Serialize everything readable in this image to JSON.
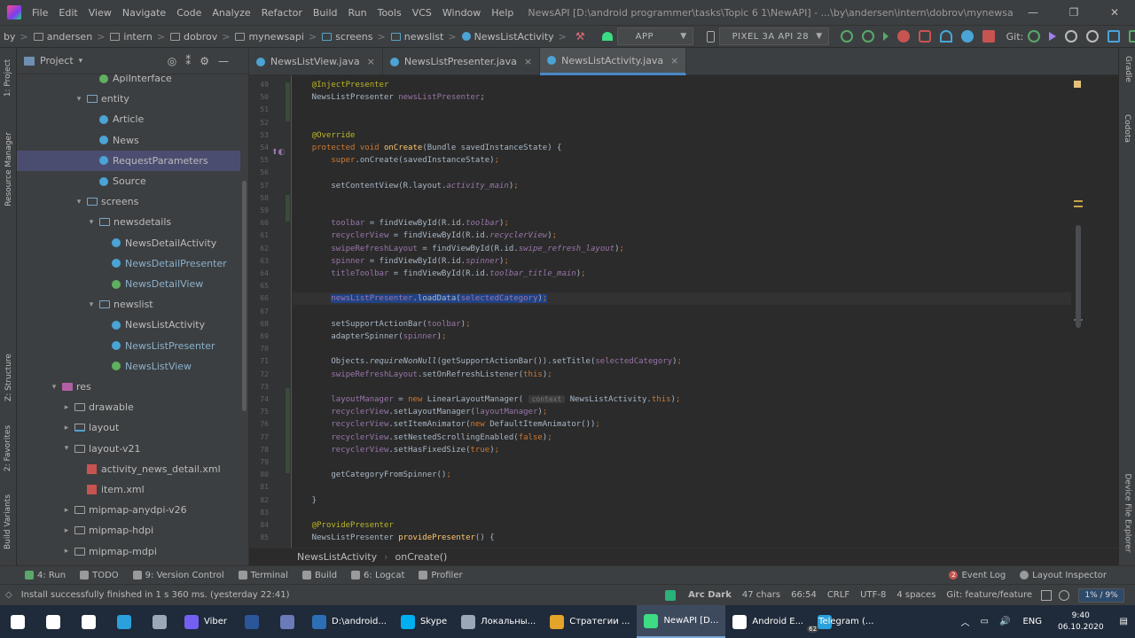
{
  "menu": [
    "File",
    "Edit",
    "View",
    "Navigate",
    "Code",
    "Analyze",
    "Refactor",
    "Build",
    "Run",
    "Tools",
    "VCS",
    "Window",
    "Help"
  ],
  "window_title": "NewsAPI [D:\\android programmer\\tasks\\Topic 6 1\\NewAPI] - ...\\by\\andersen\\intern\\dobrov\\mynewsapi\\screens\\newslist\\NewsListActivity.java [app]",
  "window_controls": [
    "—",
    "❐",
    "✕"
  ],
  "breadcrumbs": [
    "by",
    "andersen",
    "intern",
    "dobrov",
    "mynewsapi",
    "screens",
    "newslist",
    "NewsListActivity"
  ],
  "run_config": "APP",
  "device": "PIXEL 3A API 28",
  "git_label": "Git:",
  "left_stripe": [
    "1: Project",
    "Resource Manager",
    "Z: Structure",
    "2: Favorites",
    "Build Variants"
  ],
  "right_stripe": [
    "Gradle",
    "Codota",
    "Device File Explorer"
  ],
  "project_panel": {
    "title": "Project",
    "tree": [
      {
        "label": "ApiInterface",
        "icon": "interface",
        "indent": 6,
        "twisty": ""
      },
      {
        "label": "entity",
        "icon": "package",
        "indent": 5,
        "twisty": "▾"
      },
      {
        "label": "Article",
        "icon": "class",
        "indent": 6,
        "twisty": ""
      },
      {
        "label": "News",
        "icon": "class",
        "indent": 6,
        "twisty": ""
      },
      {
        "label": "RequestParameters",
        "icon": "class",
        "indent": 6,
        "twisty": "",
        "selected": true
      },
      {
        "label": "Source",
        "icon": "class",
        "indent": 6,
        "twisty": ""
      },
      {
        "label": "screens",
        "icon": "package",
        "indent": 5,
        "twisty": "▾"
      },
      {
        "label": "newsdetails",
        "icon": "package",
        "indent": 6,
        "twisty": "▾"
      },
      {
        "label": "NewsDetailActivity",
        "icon": "class",
        "indent": 7,
        "twisty": ""
      },
      {
        "label": "NewsDetailPresenter",
        "icon": "class",
        "indent": 7,
        "twisty": "",
        "muted": true
      },
      {
        "label": "NewsDetailView",
        "icon": "interface",
        "indent": 7,
        "twisty": "",
        "muted": true
      },
      {
        "label": "newslist",
        "icon": "package",
        "indent": 6,
        "twisty": "▾"
      },
      {
        "label": "NewsListActivity",
        "icon": "class",
        "indent": 7,
        "twisty": ""
      },
      {
        "label": "NewsListPresenter",
        "icon": "class",
        "indent": 7,
        "twisty": "",
        "muted": true
      },
      {
        "label": "NewsListView",
        "icon": "interface",
        "indent": 7,
        "twisty": "",
        "muted": true
      },
      {
        "label": "res",
        "icon": "res",
        "indent": 3,
        "twisty": "▾"
      },
      {
        "label": "drawable",
        "icon": "folder",
        "indent": 4,
        "twisty": "▸"
      },
      {
        "label": "layout",
        "icon": "layout",
        "indent": 4,
        "twisty": "▸"
      },
      {
        "label": "layout-v21",
        "icon": "folder",
        "indent": 4,
        "twisty": "▾"
      },
      {
        "label": "activity_news_detail.xml",
        "icon": "xml",
        "indent": 5,
        "twisty": ""
      },
      {
        "label": "item.xml",
        "icon": "xml",
        "indent": 5,
        "twisty": ""
      },
      {
        "label": "mipmap-anydpi-v26",
        "icon": "folder",
        "indent": 4,
        "twisty": "▸"
      },
      {
        "label": "mipmap-hdpi",
        "icon": "folder",
        "indent": 4,
        "twisty": "▸"
      },
      {
        "label": "mipmap-mdpi",
        "icon": "folder",
        "indent": 4,
        "twisty": "▸"
      }
    ]
  },
  "editor_tabs": [
    {
      "label": "NewsListView.java",
      "active": false
    },
    {
      "label": "NewsListPresenter.java",
      "active": false
    },
    {
      "label": "NewsListActivity.java",
      "active": true
    }
  ],
  "code_lines": [
    {
      "n": "49",
      "html": "    <span class='a'>@InjectPresenter</span>"
    },
    {
      "n": "50",
      "html": "    NewsListPresenter <span class='f'>newsListPresenter</span>;"
    },
    {
      "n": "51",
      "html": ""
    },
    {
      "n": "52",
      "html": ""
    },
    {
      "n": "53",
      "html": "    <span class='a'>@Override</span>"
    },
    {
      "n": "54",
      "html": "    <span class='k'>protected void</span> <span class='fn'>onCreate</span>(Bundle savedInstanceState) {"
    },
    {
      "n": "55",
      "html": "        <span class='k'>super</span>.onCreate(savedInstanceState)<span class='k'>;</span>"
    },
    {
      "n": "56",
      "html": ""
    },
    {
      "n": "57",
      "html": "        setContentView(R.layout.<span class='fi'>activity_main</span>)<span class='k'>;</span>"
    },
    {
      "n": "58",
      "html": ""
    },
    {
      "n": "59",
      "html": ""
    },
    {
      "n": "60",
      "html": "        <span class='f'>toolbar</span> = findViewById(R.id.<span class='fi'>toolbar</span>)<span class='k'>;</span>"
    },
    {
      "n": "61",
      "html": "        <span class='f'>recyclerView</span> = findViewById(R.id.<span class='fi'>recyclerView</span>)<span class='k'>;</span>"
    },
    {
      "n": "62",
      "html": "        <span class='f'>swipeRefreshLayout</span> = findViewById(R.id.<span class='fi'>swipe_refresh_layout</span>)<span class='k'>;</span>"
    },
    {
      "n": "63",
      "html": "        <span class='f'>spinner</span> = findViewById(R.id.<span class='fi'>spinner</span>)<span class='k'>;</span>"
    },
    {
      "n": "64",
      "html": "        <span class='f'>titleToolbar</span> = findViewById(R.id.<span class='fi'>toolbar_title_main</span>)<span class='k'>;</span>"
    },
    {
      "n": "65",
      "html": ""
    },
    {
      "n": "66",
      "html": "        <span class='sel'><span class='f'>newsListPresenter</span>.loadData(<span class='f'>selectedCategory</span>)<span class='k'>;</span></span>",
      "current": true
    },
    {
      "n": "67",
      "html": ""
    },
    {
      "n": "68",
      "html": "        setSupportActionBar(<span class='f'>toolbar</span>)<span class='k'>;</span>"
    },
    {
      "n": "69",
      "html": "        adapterSpinner(<span class='f'>spinner</span>)<span class='k'>;</span>"
    },
    {
      "n": "70",
      "html": ""
    },
    {
      "n": "71",
      "html": "        Objects.<span class='st'>requireNonNull</span>(getSupportActionBar()).setTitle(<span class='f'>selectedCategory</span>)<span class='k'>;</span>"
    },
    {
      "n": "72",
      "html": "        <span class='f'>swipeRefreshLayout</span>.setOnRefreshListener(<span class='k'>this</span>)<span class='k'>;</span>"
    },
    {
      "n": "73",
      "html": ""
    },
    {
      "n": "74",
      "html": "        <span class='f'>layoutManager</span> = <span class='k'>new</span> LinearLayoutManager( <span class='hint'>context</span> NewsListActivity.<span class='k'>this</span>)<span class='k'>;</span>"
    },
    {
      "n": "75",
      "html": "        <span class='f'>recyclerView</span>.setLayoutManager(<span class='f'>layoutManager</span>)<span class='k'>;</span>"
    },
    {
      "n": "76",
      "html": "        <span class='f'>recyclerView</span>.setItemAnimator(<span class='k'>new</span> DefaultItemAnimator())<span class='k'>;</span>"
    },
    {
      "n": "77",
      "html": "        <span class='f'>recyclerView</span>.setNestedScrollingEnabled(<span class='k'>false</span>)<span class='k'>;</span>"
    },
    {
      "n": "78",
      "html": "        <span class='f'>recyclerView</span>.setHasFixedSize(<span class='k'>true</span>)<span class='k'>;</span>"
    },
    {
      "n": "79",
      "html": ""
    },
    {
      "n": "80",
      "html": "        getCategoryFromSpinner()<span class='k'>;</span>"
    },
    {
      "n": "81",
      "html": ""
    },
    {
      "n": "82",
      "html": "    }"
    },
    {
      "n": "83",
      "html": ""
    },
    {
      "n": "84",
      "html": "    <span class='a'>@ProvidePresenter</span>"
    },
    {
      "n": "85",
      "html": "    NewsListPresenter <span class='fn'>providePresenter</span>() {"
    }
  ],
  "editor_breadcrumb": [
    "NewsListActivity",
    "onCreate()"
  ],
  "bottom_tools": [
    {
      "label": "4: Run",
      "icon": "run",
      "color": "#59a869"
    },
    {
      "label": "TODO",
      "icon": "todo",
      "color": "#9a9a9a"
    },
    {
      "label": "9: Version Control",
      "icon": "vcs",
      "color": "#9a9a9a"
    },
    {
      "label": "Terminal",
      "icon": "terminal",
      "color": "#9a9a9a"
    },
    {
      "label": "Build",
      "icon": "build",
      "color": "#9a9a9a"
    },
    {
      "label": "6: Logcat",
      "icon": "logcat",
      "color": "#9a9a9a"
    },
    {
      "label": "Profiler",
      "icon": "profiler",
      "color": "#9a9a9a"
    }
  ],
  "bottom_right_tools": [
    {
      "label": "Event Log",
      "icon": "event-log",
      "badge": "2"
    },
    {
      "label": "Layout Inspector",
      "icon": "layout-inspector"
    }
  ],
  "status": {
    "message": "Install successfully finished in 1 s 360 ms. (yesterday 22:41)",
    "theme": "Arc Dark",
    "chars": "47 chars",
    "position": "66:54",
    "line_sep": "CRLF",
    "encoding": "UTF-8",
    "indent": "4 spaces",
    "git": "Git: feature/feature",
    "memory": "1% / 9%"
  },
  "taskbar": {
    "items": [
      {
        "label": "",
        "icon": "windows-start-icon",
        "color": "#ffffff"
      },
      {
        "label": "",
        "icon": "search-icon",
        "color": "#ffffff"
      },
      {
        "label": "",
        "icon": "task-view-icon",
        "color": "#ffffff"
      },
      {
        "label": "",
        "icon": "telegram-icon",
        "color": "#2aa1da"
      },
      {
        "label": "",
        "icon": "app-icon",
        "color": "#9aa8b8"
      },
      {
        "label": "Viber",
        "icon": "viber-icon",
        "color": "#7360f2"
      },
      {
        "label": "",
        "icon": "word-icon",
        "color": "#2b579a"
      },
      {
        "label": "",
        "icon": "save-icon",
        "color": "#6a7bb8"
      },
      {
        "label": "D:\\android...",
        "icon": "powershell-icon",
        "color": "#2d6fb5"
      },
      {
        "label": "Skype",
        "icon": "skype-icon",
        "color": "#00aff0"
      },
      {
        "label": "Локальны...",
        "icon": "drive-icon",
        "color": "#9aa8b8"
      },
      {
        "label": "Стратегии ...",
        "icon": "chrome-icon",
        "color": "#e4a42a"
      },
      {
        "label": "NewAPI [D...",
        "icon": "android-studio-icon",
        "color": "#3ddc84",
        "active": true
      },
      {
        "label": "Android E...",
        "icon": "android-emulator-icon",
        "color": "#ffffff"
      },
      {
        "label": "Telegram (...",
        "icon": "telegram-icon",
        "color": "#2aa1da",
        "badge": "62"
      }
    ],
    "lang": "ENG",
    "time": "9:40",
    "date": "06.10.2020"
  }
}
